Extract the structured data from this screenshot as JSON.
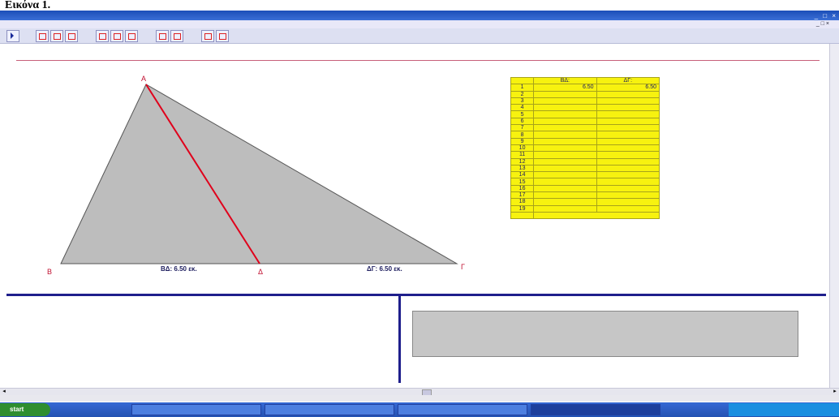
{
  "caption": {
    "prefix": "Εικόνα 1.",
    "text": ""
  },
  "window": {
    "title": "",
    "controls": "_ □ ×"
  },
  "menubar": {
    "items": [
      "",
      "",
      "",
      "",
      ""
    ],
    "controls": "_ □ ×"
  },
  "figure": {
    "header_left": "",
    "header_right": "",
    "vertex_A": "Α",
    "vertex_B": "Β",
    "vertex_G": "Γ",
    "point_D": "Δ",
    "measure_BD": "ΒΔ: 6.50 εκ.",
    "measure_DG": "ΔΓ: 6.50 εκ."
  },
  "table": {
    "headers": [
      "",
      "ΒΔ:",
      "ΔΓ:"
    ],
    "rows": [
      [
        "1",
        "6.50",
        "6.50"
      ],
      [
        "2",
        "",
        ""
      ],
      [
        "3",
        "",
        ""
      ],
      [
        "4",
        "",
        ""
      ],
      [
        "5",
        "",
        ""
      ],
      [
        "6",
        "",
        ""
      ],
      [
        "7",
        "",
        ""
      ],
      [
        "8",
        "",
        ""
      ],
      [
        "9",
        "",
        ""
      ],
      [
        "10",
        "",
        ""
      ],
      [
        "11",
        "",
        ""
      ],
      [
        "12",
        "",
        ""
      ],
      [
        "13",
        "",
        ""
      ],
      [
        "14",
        "",
        ""
      ],
      [
        "15",
        "",
        ""
      ],
      [
        "16",
        "",
        ""
      ],
      [
        "17",
        "",
        ""
      ],
      [
        "18",
        "",
        ""
      ],
      [
        "19",
        "",
        ""
      ]
    ],
    "footer": ""
  },
  "instructions": "",
  "question": "",
  "answer_label": "",
  "statusbar": "",
  "taskbar": {
    "start": "start",
    "tasks": [
      "",
      "",
      "",
      "",
      ""
    ],
    "clock": ""
  },
  "colors": {
    "triangle_fill": "#bdbdbd",
    "median": "#e0001b",
    "table_bg": "#f7f20f",
    "accent_text": "#cc0aa5"
  }
}
